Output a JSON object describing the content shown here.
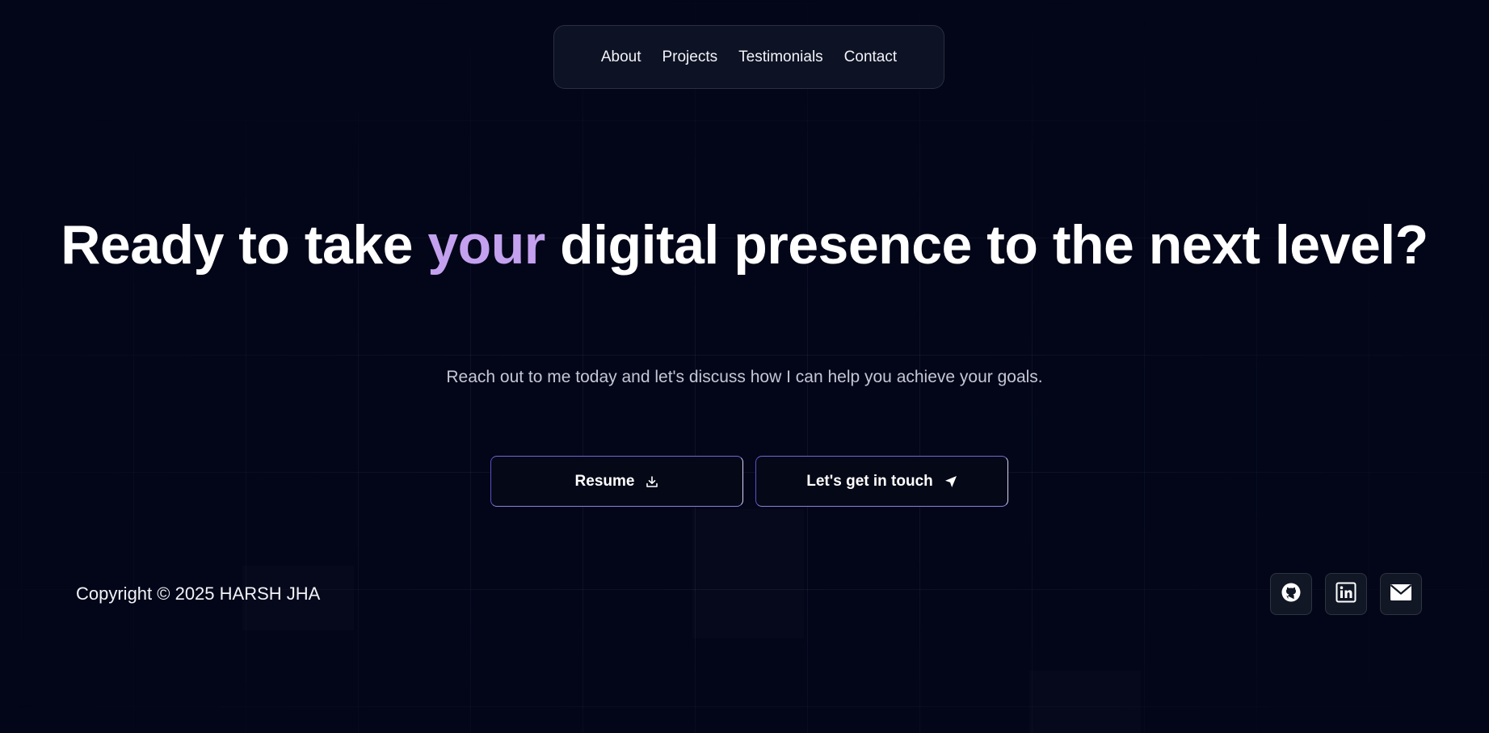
{
  "nav": {
    "items": [
      {
        "label": "About"
      },
      {
        "label": "Projects"
      },
      {
        "label": "Testimonials"
      },
      {
        "label": "Contact"
      }
    ]
  },
  "hero": {
    "headline_before": "Ready to take ",
    "headline_accent": "your",
    "headline_after": " digital presence to the next level?",
    "subtitle": "Reach out to me today and let's discuss how I can help you achieve your goals.",
    "accent_color": "#c3a1ef"
  },
  "buttons": {
    "resume_label": "Resume",
    "resume_icon": "download-icon",
    "touch_label": "Let's get in touch",
    "touch_icon": "send-arrow-icon"
  },
  "footer": {
    "copyright": "Copyright © 2025 HARSH JHA",
    "social": [
      {
        "icon": "github-icon"
      },
      {
        "icon": "linkedin-icon"
      },
      {
        "icon": "mail-icon"
      }
    ]
  },
  "colors": {
    "background": "#030618",
    "nav_background": "#0d1224",
    "button_border": "#5b4fc8"
  }
}
